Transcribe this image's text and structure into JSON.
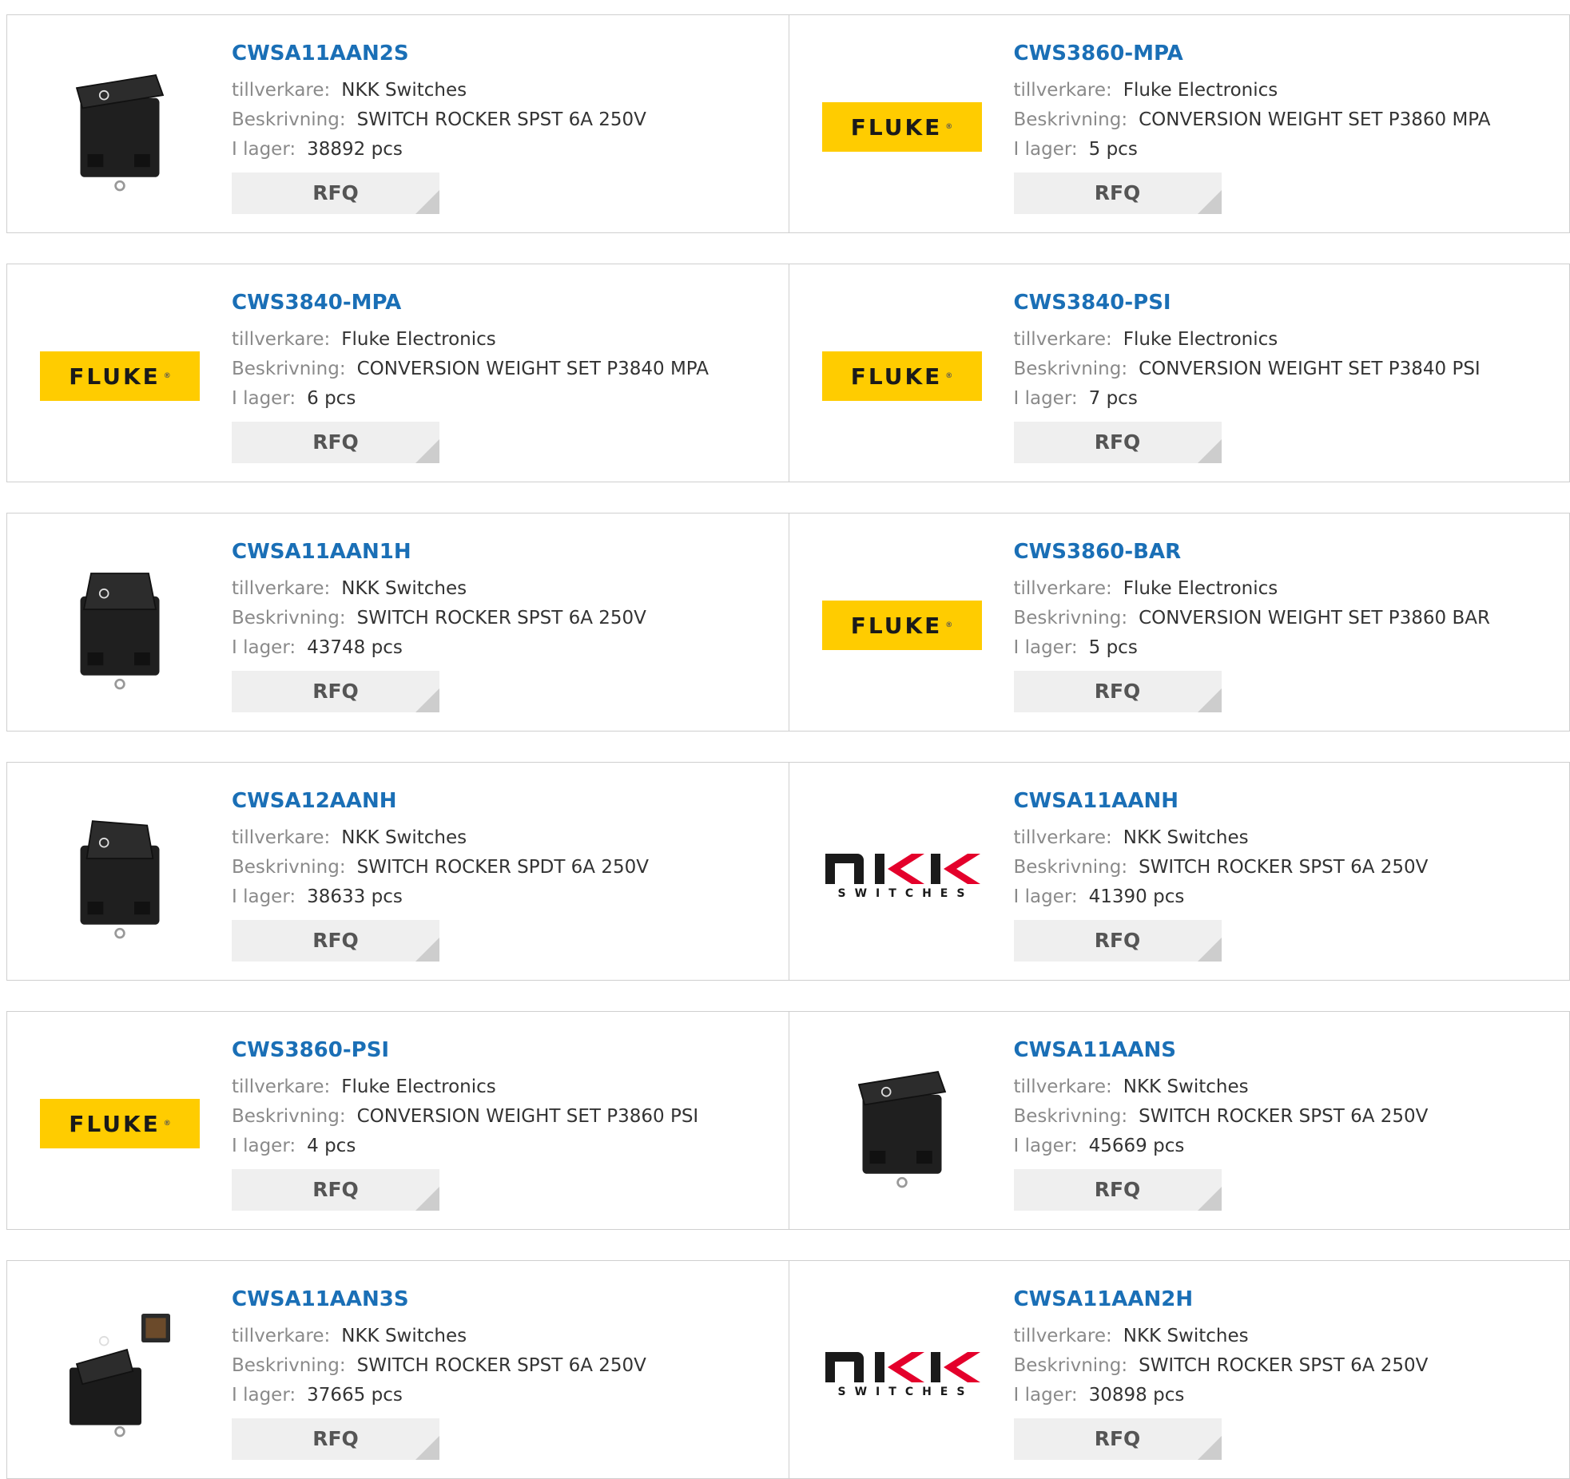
{
  "labels": {
    "manufacturer": "tillverkare:",
    "description": "Beskrivning:",
    "stock": "I lager:",
    "rfq": "RFQ"
  },
  "brand": {
    "fluke_text": "FLUKE",
    "fluke_reg": "®",
    "nkk_switches_text": "SWITCHES",
    "fluke_color": "#ffcc00",
    "link_color": "#1a6fb6"
  },
  "products": [
    {
      "part": "CWSA11AAN2S",
      "manufacturer": "NKK Switches",
      "description": "SWITCH ROCKER SPST 6A 250V",
      "stock": "38892 pcs",
      "image": "rocker-switch-a"
    },
    {
      "part": "CWS3860-MPA",
      "manufacturer": "Fluke Electronics",
      "description": "CONVERSION WEIGHT SET P3860 MPA",
      "stock": "5 pcs",
      "image": "fluke-logo"
    },
    {
      "part": "CWS3840-MPA",
      "manufacturer": "Fluke Electronics",
      "description": "CONVERSION WEIGHT SET P3840 MPA",
      "stock": "6 pcs",
      "image": "fluke-logo"
    },
    {
      "part": "CWS3840-PSI",
      "manufacturer": "Fluke Electronics",
      "description": "CONVERSION WEIGHT SET P3840 PSI",
      "stock": "7 pcs",
      "image": "fluke-logo"
    },
    {
      "part": "CWSA11AAN1H",
      "manufacturer": "NKK Switches",
      "description": "SWITCH ROCKER SPST 6A 250V",
      "stock": "43748 pcs",
      "image": "rocker-switch-b"
    },
    {
      "part": "CWS3860-BAR",
      "manufacturer": "Fluke Electronics",
      "description": "CONVERSION WEIGHT SET P3860 BAR",
      "stock": "5 pcs",
      "image": "fluke-logo"
    },
    {
      "part": "CWSA12AANH",
      "manufacturer": "NKK Switches",
      "description": "SWITCH ROCKER SPDT 6A 250V",
      "stock": "38633 pcs",
      "image": "rocker-switch-c"
    },
    {
      "part": "CWSA11AANH",
      "manufacturer": "NKK Switches",
      "description": "SWITCH ROCKER SPST 6A 250V",
      "stock": "41390 pcs",
      "image": "nkk-logo"
    },
    {
      "part": "CWS3860-PSI",
      "manufacturer": "Fluke Electronics",
      "description": "CONVERSION WEIGHT SET P3860 PSI",
      "stock": "4 pcs",
      "image": "fluke-logo"
    },
    {
      "part": "CWSA11AANS",
      "manufacturer": "NKK Switches",
      "description": "SWITCH ROCKER SPST 6A 250V",
      "stock": "45669 pcs",
      "image": "rocker-switch-a"
    },
    {
      "part": "CWSA11AAN3S",
      "manufacturer": "NKK Switches",
      "description": "SWITCH ROCKER SPST 6A 250V",
      "stock": "37665 pcs",
      "image": "rocker-switch-d"
    },
    {
      "part": "CWSA11AAN2H",
      "manufacturer": "NKK Switches",
      "description": "SWITCH ROCKER SPST 6A 250V",
      "stock": "30898 pcs",
      "image": "nkk-logo"
    }
  ]
}
